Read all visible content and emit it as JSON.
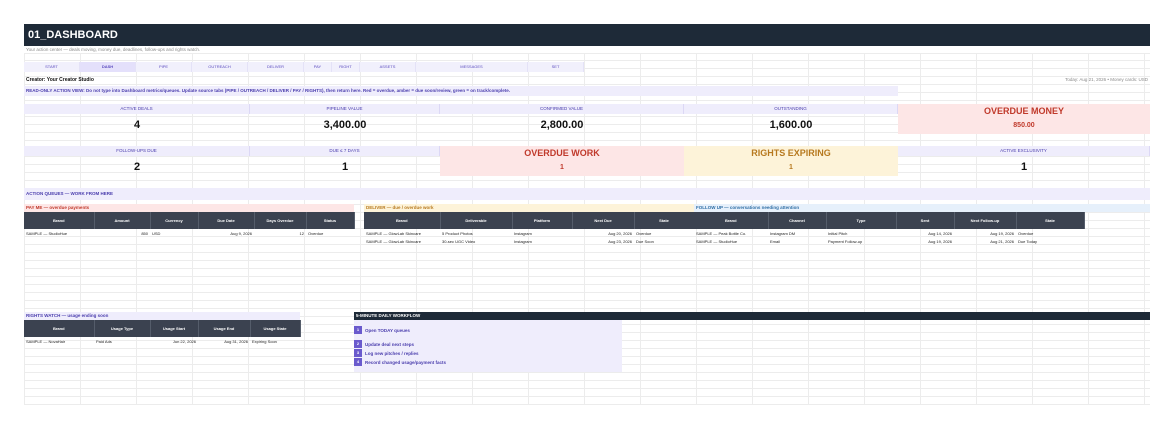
{
  "title": "01_DASHBOARD",
  "subtitle": "Your action center — deals moving, money due, deadlines, follow-ups and rights watch.",
  "nav": [
    "START",
    "DASH",
    "PIPE",
    "OUTREACH",
    "DELIVER",
    "PAY",
    "RIGHT",
    "ASSETS",
    "MESSAGES",
    "SET"
  ],
  "creator": "Creator: Your Creator Studio",
  "today": "Today: Aug 21, 2026 • Money cards: USD",
  "banner": "READ-ONLY ACTION VIEW: Do not type into Dashboard metrics/queues. Update source tabs (PIPE / OUTREACH / DELIVER / PAY / RIGHTS), then return here. Red = overdue, amber = due soon/review, green = on track/complete.",
  "kpi_row1": {
    "active_deals": {
      "label": "ACTIVE DEALS",
      "value": "4"
    },
    "pipeline_value": {
      "label": "PIPELINE VALUE",
      "value": "3,400.00"
    },
    "confirmed_value": {
      "label": "CONFIRMED VALUE",
      "value": "2,800.00"
    },
    "outstanding": {
      "label": "OUTSTANDING",
      "value": "1,600.00"
    },
    "overdue_money": {
      "label": "OVERDUE MONEY",
      "value": "850.00"
    }
  },
  "kpi_row2": {
    "followups_due": {
      "label": "FOLLOW-UPS DUE",
      "value": "2"
    },
    "due_7_days": {
      "label": "DUE ≤ 7 DAYS",
      "value": "1"
    },
    "overdue_work": {
      "label": "OVERDUE WORK",
      "value": "1"
    },
    "rights_expiring": {
      "label": "RIGHTS EXPIRING",
      "value": "1"
    },
    "active_exclusivity": {
      "label": "ACTIVE EXCLUSIVITY",
      "value": "1"
    }
  },
  "action_queues_label": "ACTION QUEUES — WORK FROM HERE",
  "pay_me": {
    "title": "PAY ME — overdue payments",
    "headers": [
      "Brand",
      "Amount",
      "Currency",
      "Due Date",
      "Days Overdue",
      "Status"
    ],
    "rows": [
      [
        "SAMPLE — StudioHue",
        "850",
        "USD",
        "Aug 9, 2026",
        "12",
        "Overdue"
      ]
    ]
  },
  "deliver": {
    "title": "DELIVER — due / overdue work",
    "headers": [
      "Brand",
      "Deliverable",
      "Platform",
      "Next Due",
      "State"
    ],
    "rows": [
      [
        "SAMPLE — GlowLab Skincare",
        "5 Product Photos",
        "Instagram",
        "Aug 20, 2026",
        "Overdue"
      ],
      [
        "SAMPLE — GlowLab Skincare",
        "30-sec UGC Video",
        "Instagram",
        "Aug 23, 2026",
        "Due Soon"
      ]
    ]
  },
  "follow_up": {
    "title": "FOLLOW UP — conversations needing attention",
    "headers": [
      "Brand",
      "Channel",
      "Type",
      "Sent",
      "Next Follow-up",
      "State"
    ],
    "rows": [
      [
        "SAMPLE — Peak Bottle Co.",
        "Instagram DM",
        "Initial Pitch",
        "Aug 14, 2026",
        "Aug 19, 2026",
        "Overdue"
      ],
      [
        "SAMPLE — StudioHue",
        "Email",
        "Payment Follow-up",
        "Aug 19, 2026",
        "Aug 21, 2026",
        "Due Today"
      ]
    ]
  },
  "rights_watch": {
    "title": "RIGHTS WATCH — usage ending soon",
    "headers": [
      "Brand",
      "Usage Type",
      "Usage Start",
      "Usage End",
      "Usage State"
    ],
    "rows": [
      [
        "SAMPLE — NovaHair",
        "Paid Ads",
        "Jun 22, 2026",
        "Aug 31, 2026",
        "Expiring Soon"
      ]
    ]
  },
  "workflow": {
    "title": "5-MINUTE DAILY WORKFLOW",
    "steps": [
      {
        "num": "1",
        "text": "Open TODAY queues"
      },
      {
        "num": "2",
        "text": "Update deal next steps"
      },
      {
        "num": "3",
        "text": "Log new pitches / replies"
      },
      {
        "num": "4",
        "text": "Record changed usage/payment facts"
      }
    ]
  },
  "colors": {
    "header": "#1e2a38",
    "accent": "#4a3dad",
    "overdue": "#c0392b",
    "amber": "#b7791f"
  }
}
